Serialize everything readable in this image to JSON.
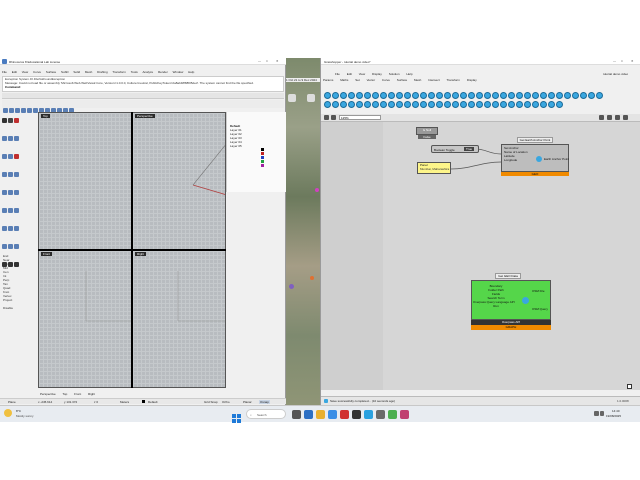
{
  "rhino": {
    "title": "Rhinoceros 8 Educational Lab License",
    "menu": [
      "File",
      "Edit",
      "View",
      "Curve",
      "Surface",
      "SubD",
      "Solid",
      "Mesh",
      "Drafting",
      "Transform",
      "Tools",
      "Analyze",
      "Render",
      "Window",
      "Help"
    ],
    "command_history_1": "Exception System.IO.FileNotFoundException",
    "command_history_2": "Message: Could not load file or assembly 'Microsoft.Web.WebView2.Core, Version=1.0.0.0, Culture=neutral, PublicKeyToken=2a8ab48f88f05ded'. The system cannot find the file specified.",
    "command_label": "Command:",
    "viewports": {
      "top": "Top",
      "perspective": "Perspective",
      "front": "Front",
      "right": "Right"
    },
    "layers": [
      "Default",
      "Layer 01",
      "Layer 02",
      "Layer 03",
      "Layer 04",
      "Layer 05"
    ],
    "osnaps": [
      "End",
      "Near",
      "Point",
      "Mid",
      "Cen",
      "Int",
      "Perp",
      "Tan",
      "Quad",
      "Knot",
      "Vertex",
      "Project",
      "Disable"
    ],
    "viewport_tabs": [
      "Perspective",
      "Top",
      "Front",
      "Right"
    ],
    "status": {
      "plane": "Plane",
      "x": "x -245.614",
      "y": "y 131.372",
      "z": "z 0",
      "units": "Meters",
      "layer": "Default",
      "grid_snap": "Grid Snap",
      "ortho": "Ortho",
      "planar": "Planar",
      "osnap": "Osnap"
    }
  },
  "map": {
    "label": "1 Oct 21 to 9 Dec 2024"
  },
  "grasshopper": {
    "title": "Grasshopper - tutorial demo video*",
    "right_title": "tutorial demo video",
    "menu": [
      "File",
      "Edit",
      "View",
      "Display",
      "Solution",
      "Help"
    ],
    "tabs": [
      "Params",
      "Maths",
      "Set",
      "Vector",
      "Curve",
      "Surface",
      "Mesh",
      "Intersect",
      "Transform",
      "Display"
    ],
    "zoom": "125%",
    "nodes": {
      "boolean_toggle": "Boolean Toggle",
      "toggle_value": "True",
      "panel_label": "Panel",
      "panel_value": "Mumbai, Maharashtra",
      "gh_comp_top_a": "Is Null",
      "gh_comp_top_b": "False",
      "http_label": "Get Earth Anchor Point",
      "http_inputs": [
        "Set Anchor",
        "Name of Location",
        "Latitude",
        "Longitude"
      ],
      "http_output": "Earth Anchor Point",
      "http_footer": "GEO",
      "geo_label": "Get GEO Data",
      "geo_inputs": [
        "Boundary",
        "Folder Path",
        "Fields",
        "Search Term",
        "Overpass Query Language API",
        "Run"
      ],
      "geo_outputs": [
        "OSM File",
        "OSM Query"
      ],
      "geo_footer": "Overpass API",
      "geo_footer2": "GRAPH"
    },
    "status": "Save successfully completed... (10 seconds ago)",
    "version": "1.0.0008"
  },
  "taskbar": {
    "temp": "8°C",
    "weather": "Mostly sunny",
    "search": "Search",
    "time": "14:40",
    "date": "19/08/2025"
  }
}
